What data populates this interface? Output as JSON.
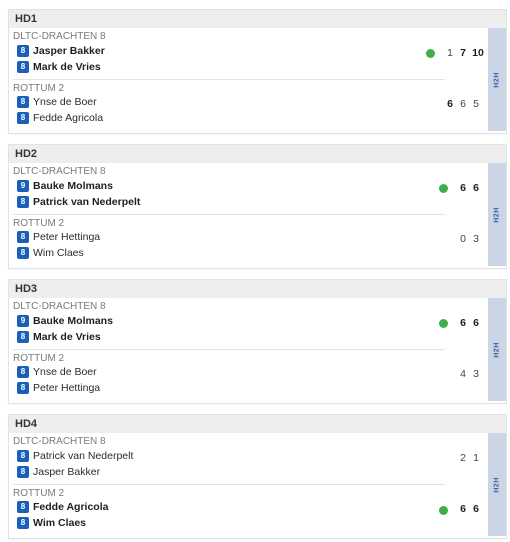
{
  "matches": [
    {
      "label": "HD1",
      "home_team": "DLTC-DRACHTEN 8",
      "home_players": [
        {
          "rating": "8",
          "name": "Jasper Bakker"
        },
        {
          "rating": "8",
          "name": "Mark de Vries"
        }
      ],
      "away_team": "ROTTUM 2",
      "away_players": [
        {
          "rating": "8",
          "name": "Ynse de Boer"
        },
        {
          "rating": "8",
          "name": "Fedde Agricola"
        }
      ],
      "home_scores": [
        "1",
        "7",
        "10"
      ],
      "away_scores": [
        "6",
        "6",
        "5"
      ],
      "h2h": "H2H"
    },
    {
      "label": "HD2",
      "home_team": "DLTC-DRACHTEN 8",
      "home_players": [
        {
          "rating": "9",
          "name": "Bauke Molmans"
        },
        {
          "rating": "8",
          "name": "Patrick van Nederpelt"
        }
      ],
      "away_team": "ROTTUM 2",
      "away_players": [
        {
          "rating": "8",
          "name": "Peter Hettinga"
        },
        {
          "rating": "8",
          "name": "Wim Claes"
        }
      ],
      "home_scores": [
        "6",
        "6"
      ],
      "away_scores": [
        "0",
        "3"
      ],
      "h2h": "H2H"
    },
    {
      "label": "HD3",
      "home_team": "DLTC-DRACHTEN 8",
      "home_players": [
        {
          "rating": "9",
          "name": "Bauke Molmans"
        },
        {
          "rating": "8",
          "name": "Mark de Vries"
        }
      ],
      "away_team": "ROTTUM 2",
      "away_players": [
        {
          "rating": "8",
          "name": "Ynse de Boer"
        },
        {
          "rating": "8",
          "name": "Peter Hettinga"
        }
      ],
      "home_scores": [
        "6",
        "6"
      ],
      "away_scores": [
        "4",
        "3"
      ],
      "h2h": "H2H"
    },
    {
      "label": "HD4",
      "home_team": "DLTC-DRACHTEN 8",
      "home_players": [
        {
          "rating": "8",
          "name": "Patrick van Nederpelt"
        },
        {
          "rating": "8",
          "name": "Jasper Bakker"
        }
      ],
      "away_team": "ROTTUM 2",
      "away_players": [
        {
          "rating": "8",
          "name": "Fedde Agricola"
        },
        {
          "rating": "8",
          "name": "Wim Claes"
        }
      ],
      "home_scores": [
        "2",
        "1"
      ],
      "away_scores": [
        "6",
        "6"
      ],
      "h2h": "H2H"
    }
  ],
  "colors": {
    "winner_dot": "#3fae49",
    "rating_badge": "#1c5fb8",
    "h2h_bg": "#ccd5e6"
  }
}
